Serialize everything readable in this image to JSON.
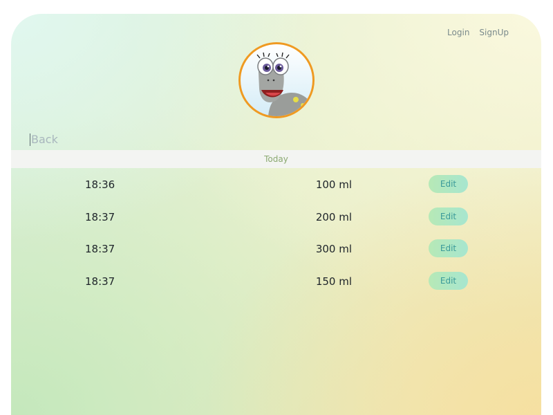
{
  "nav": {
    "login_label": "Login",
    "signup_label": "SignUp"
  },
  "avatar": {
    "icon": "dinosaur-mascot",
    "border_color": "#ef9a22"
  },
  "back_label": "Back",
  "day_header": "Today",
  "entries": [
    {
      "time": "18:36",
      "amount": "100 ml",
      "edit_label": "Edit"
    },
    {
      "time": "18:37",
      "amount": "200 ml",
      "edit_label": "Edit"
    },
    {
      "time": "18:37",
      "amount": "300 ml",
      "edit_label": "Edit"
    },
    {
      "time": "18:37",
      "amount": "150 ml",
      "edit_label": "Edit"
    }
  ],
  "colors": {
    "accent": "#ef9a22",
    "edit_button": "#a7e6cf",
    "header_text": "#8aa870"
  }
}
